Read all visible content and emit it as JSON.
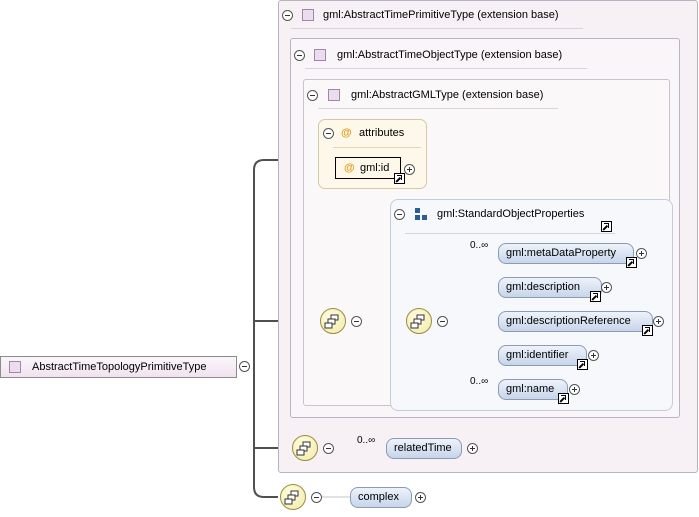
{
  "root": {
    "label": "AbstractTimeTopologyPrimitiveType"
  },
  "ext1": {
    "label": "gml:AbstractTimePrimitiveType (extension base)"
  },
  "ext2": {
    "label": "gml:AbstractTimeObjectType (extension base)"
  },
  "ext3": {
    "label": "gml:AbstractGMLType (extension base)"
  },
  "attributes": {
    "label": "attributes",
    "items": [
      {
        "label": "gml:id"
      }
    ]
  },
  "group": {
    "label": "gml:StandardObjectProperties",
    "elements": [
      {
        "label": "gml:metaDataProperty",
        "card": "0..∞"
      },
      {
        "label": "gml:description"
      },
      {
        "label": "gml:descriptionReference"
      },
      {
        "label": "gml:identifier"
      },
      {
        "label": "gml:name",
        "card": "0..∞"
      }
    ]
  },
  "related": {
    "label": "relatedTime",
    "card": "0..∞"
  },
  "complex": {
    "label": "complex"
  }
}
